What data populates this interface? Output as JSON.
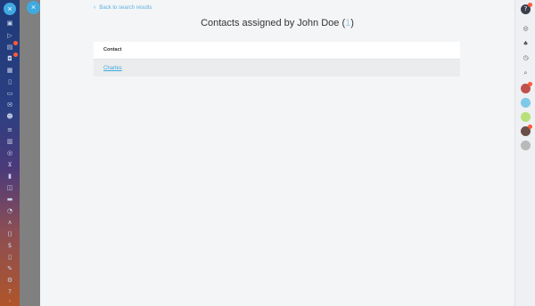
{
  "panel": {
    "close_symbol": "×",
    "back_link": "Back to search results",
    "title": "Contacts assigned by John Doe",
    "count": "1"
  },
  "table": {
    "header": "Contact",
    "rows": [
      {
        "name": "Charles"
      }
    ]
  },
  "left_nav": {
    "close_symbol": "×",
    "icons": [
      "desktop-icon",
      "feed-icon",
      "tasks-icon",
      "chat-icon",
      "calendar-icon",
      "document-icon",
      "drive-icon",
      "mail-icon",
      "groups-icon",
      "filter-icon",
      "store-icon",
      "target-icon",
      "cart-icon",
      "chart-icon",
      "crm-icon",
      "booking-icon",
      "time-icon",
      "analytics-icon",
      "code-icon",
      "dollar-icon",
      "file-icon",
      "pen-icon",
      "settings-icon",
      "help-icon",
      "user-icon"
    ],
    "badges": [
      "tasks-icon",
      "chat-icon"
    ]
  },
  "right_bar": {
    "icons": [
      "help-icon",
      "settings-icon",
      "bell-icon",
      "timer-icon",
      "search-icon"
    ],
    "avatars": [
      "avatar-1",
      "avatar-2",
      "avatar-3",
      "avatar-4",
      "avatar-5"
    ]
  },
  "colors": {
    "accent": "#3fa9e0",
    "badge": "#ff5a3c"
  }
}
